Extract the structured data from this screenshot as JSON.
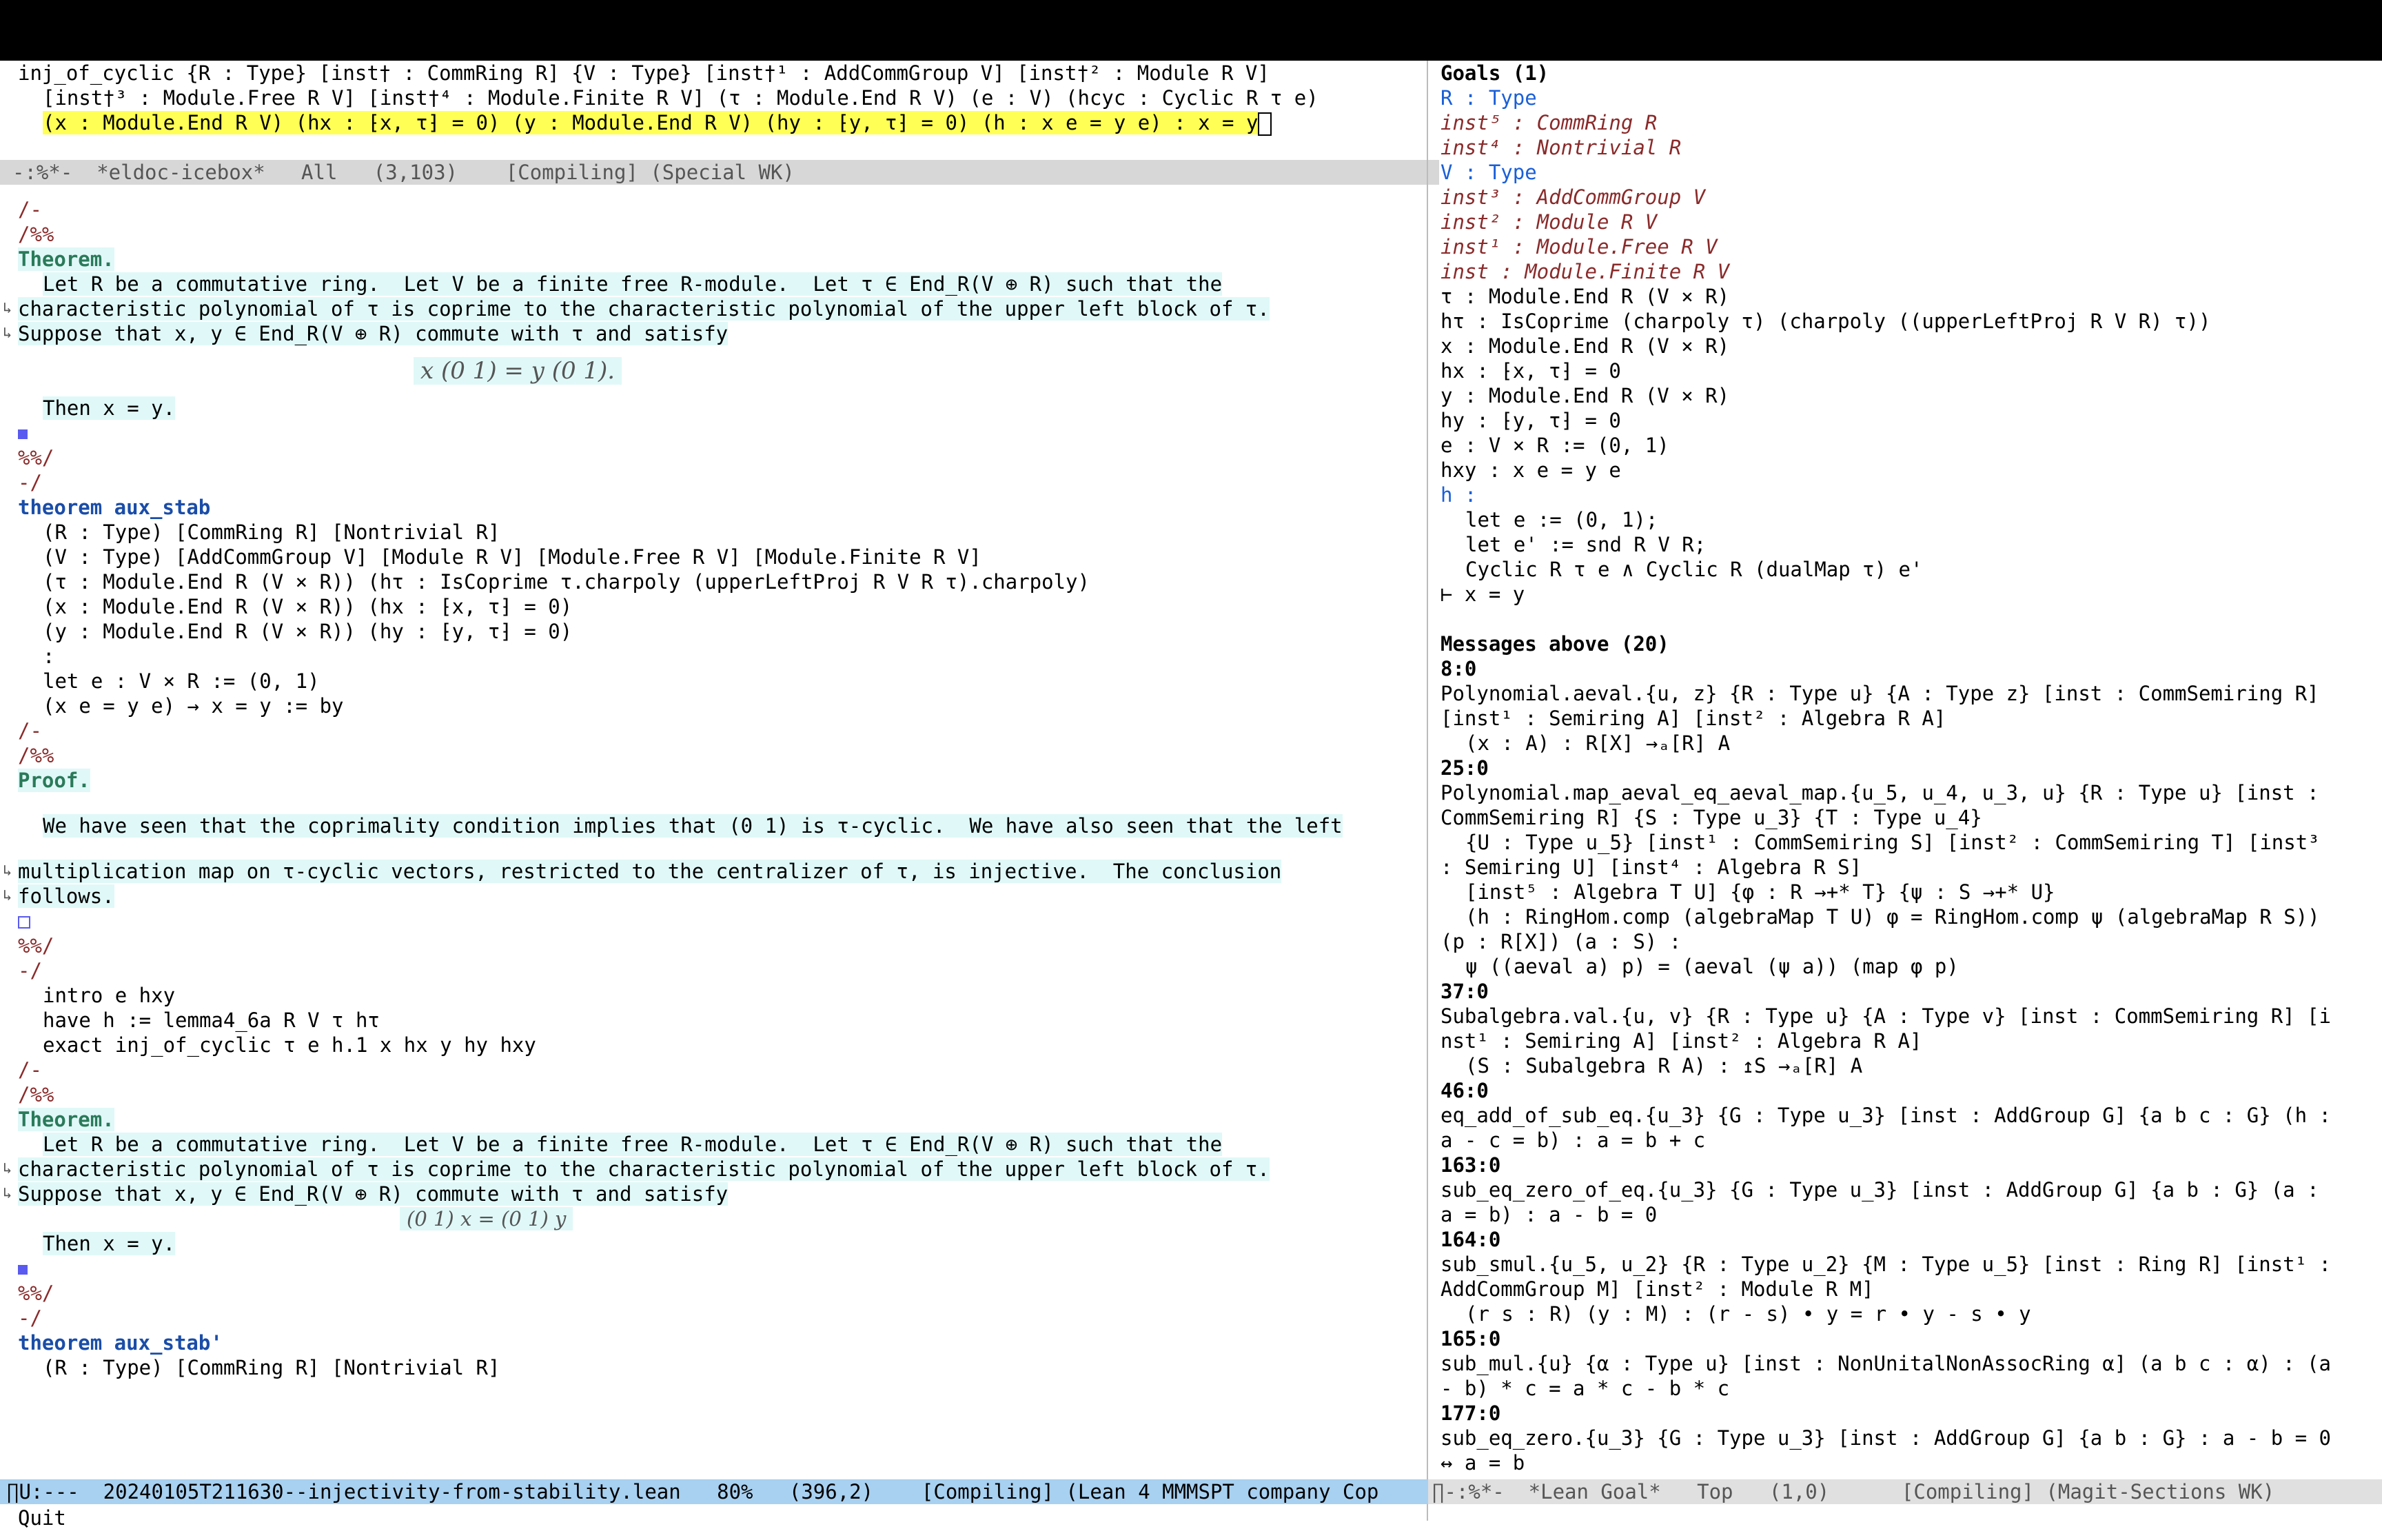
{
  "top_sig": [
    "inj_of_cyclic {R : Type} [inst† : CommRing R] {V : Type} [inst†¹ : AddCommGroup V] [inst†² : Module R V]",
    "[inst†³ : Module.Free R V] [inst†⁴ : Module.Finite R V] (τ : Module.End R V) (e : V) (hcyc : Cyclic R τ e)",
    "(x : Module.End R V) (hx : ⁅x, τ⁆ = 0) (y : Module.End R V) (hy : ⁅y, τ⁆ = 0) (h : x e = y e) : x = y"
  ],
  "modeline_top": "-:%*-  *eldoc-icebox*   All   (3,103)    [Compiling] (Special WK)",
  "left_lines": [
    "/-",
    "/%%",
    "Theorem.",
    "Let R be a commutative ring.  Let V be a finite free R-module.  Let τ ∈ End_R(V ⊕ R) such that the",
    "characteristic polynomial of τ is coprime to the characteristic polynomial of the upper left block of τ.",
    "Suppose that x, y ∈ End_R(V ⊕ R) commute with τ and satisfy",
    "x (0 1) = y (0 1).",
    "Then x = y.",
    "■",
    "%%/",
    "-/",
    "theorem aux_stab",
    "(R : Type) [CommRing R] [Nontrivial R]",
    "(V : Type) [AddCommGroup V] [Module R V] [Module.Free R V] [Module.Finite R V]",
    "(τ : Module.End R (V × R)) (hτ : IsCoprime τ.charpoly (upperLeftProj R V R τ).charpoly)",
    "(x : Module.End R (V × R)) (hx : ⁅x, τ⁆ = 0)",
    "(y : Module.End R (V × R)) (hy : ⁅y, τ⁆ = 0)",
    ":",
    "let e : V × R := (0, 1)",
    "(x e = y e) → x = y := by",
    "/-",
    "/%%",
    "Proof.",
    "We have seen that the coprimality condition implies that (0 1) is τ-cyclic.  We have also seen that the left",
    "multiplication map on τ-cyclic vectors, restricted to the centralizer of τ, is injective.  The conclusion",
    "follows.",
    "□",
    "%%/",
    "-/",
    "intro e hxy",
    "have h := lemma4_6a R V τ hτ",
    "exact inj_of_cyclic τ e h.1 x hx y hy hxy",
    "/-",
    "/%%",
    "Theorem.",
    "Let R be a commutative ring.  Let V be a finite free R-module.  Let τ ∈ End_R(V ⊕ R) such that the",
    "characteristic polynomial of τ is coprime to the characteristic polynomial of the upper left block of τ.",
    "Suppose that x, y ∈ End_R(V ⊕ R) commute with τ and satisfy",
    "(0 1) x = (0 1) y",
    "Then x = y.",
    "■",
    "%%/",
    "-/",
    "theorem aux_stab'",
    "(R : Type) [CommRing R] [Nontrivial R]"
  ],
  "modeline_left": "∏U:---  20240105T211630--injectivity-from-stability.lean   80%   (396,2)    [Compiling] (Lean 4 MMMSPT company Cop",
  "right_lines": [
    "Goals (1)",
    "R : Type",
    "inst⁵ : CommRing R",
    "inst⁴ : Nontrivial R",
    "V : Type",
    "inst³ : AddCommGroup V",
    "inst² : Module R V",
    "inst¹ : Module.Free R V",
    "inst : Module.Finite R V",
    "τ : Module.End R (V × R)",
    "hτ : IsCoprime (charpoly τ) (charpoly ((upperLeftProj R V R) τ))",
    "x : Module.End R (V × R)",
    "hx : ⁅x, τ⁆ = 0",
    "y : Module.End R (V × R)",
    "hy : ⁅y, τ⁆ = 0",
    "e : V × R := (0, 1)",
    "hxy : x e = y e",
    "h :",
    "let e := (0, 1);",
    "let e' := snd R V R;",
    "Cyclic R τ e ∧ Cyclic R (dualMap τ) e'",
    "⊢ x = y",
    "Messages above (20)",
    "8:0",
    "Polynomial.aeval.{u, z} {R : Type u} {A : Type z} [inst : CommSemiring R]",
    "[inst¹ : Semiring A] [inst² : Algebra R A]",
    "(x : A) : R[X] →ₐ[R] A",
    "25:0",
    "Polynomial.map_aeval_eq_aeval_map.{u_5, u_4, u_3, u} {R : Type u} [inst :",
    "CommSemiring R] {S : Type u_3} {T : Type u_4}",
    "{U : Type u_5} [inst¹ : CommSemiring S] [inst² : CommSemiring T] [inst³",
    ": Semiring U] [inst⁴ : Algebra R S]",
    "[inst⁵ : Algebra T U] {φ : R →+* T} {ψ : S →+* U}",
    "(h : RingHom.comp (algebraMap T U) φ = RingHom.comp ψ (algebraMap R S))",
    "(p : R[X]) (a : S) :",
    "ψ ((aeval a) p) = (aeval (ψ a)) (map φ p)",
    "37:0",
    "Subalgebra.val.{u, v} {R : Type u} {A : Type v} [inst : CommSemiring R] [i",
    "nst¹ : Semiring A] [inst² : Algebra R A]",
    "(S : Subalgebra R A) : ↥S →ₐ[R] A",
    "46:0",
    "eq_add_of_sub_eq.{u_3} {G : Type u_3} [inst : AddGroup G] {a b c : G} (h :",
    "a - c = b) : a = b + c",
    "163:0",
    "sub_eq_zero_of_eq.{u_3} {G : Type u_3} [inst : AddGroup G] {a b : G} (a :",
    "a = b) : a - b = 0",
    "164:0",
    "sub_smul.{u_5, u_2} {R : Type u_2} {M : Type u_5} [inst : Ring R] [inst¹ :",
    "AddCommGroup M] [inst² : Module R M]",
    "(r s : R) (y : M) : (r - s) • y = r • y - s • y",
    "165:0",
    "sub_mul.{u} {α : Type u} [inst : NonUnitalNonAssocRing α] (a b c : α) : (a",
    "- b) * c = a * c - b * c",
    "177:0",
    "sub_eq_zero.{u_3} {G : Type u_3} [inst : AddGroup G] {a b : G} : a - b = 0",
    "↔ a = b"
  ],
  "modeline_right": "∏-:%*-  *Lean Goal*   Top   (1,0)      [Compiling] (Magit-Sections WK)",
  "minibuffer": "Quit"
}
